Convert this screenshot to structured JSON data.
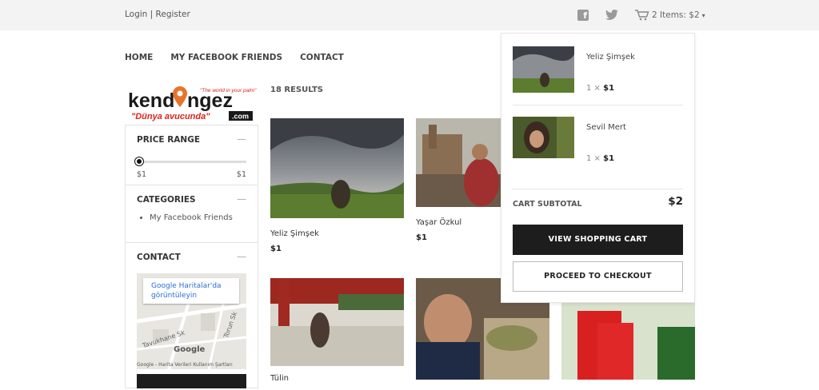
{
  "topbar": {
    "login": "Login",
    "sep": " | ",
    "register": "Register",
    "cart_link": "2 Items: $2"
  },
  "nav": {
    "items": [
      "HOME",
      "MY FACEBOOK FRIENDS",
      "CONTACT"
    ]
  },
  "logo": {
    "text_main": "kend",
    "text_rest": "ngez",
    "tagline": "\"The world in your palm\"",
    "subtitle": "\"Dünya avucunda\"",
    "dotcom": ".com"
  },
  "results": "18 RESULTS",
  "sidebar": {
    "price": {
      "title": "PRICE RANGE",
      "min": "$1",
      "max": "$1",
      "slider_position": 0
    },
    "categories": {
      "title": "CATEGORIES",
      "items": [
        "My Facebook Friends"
      ]
    },
    "contact": {
      "title": "CONTACT",
      "map_tip": "Google Haritalar'da görüntüleyin",
      "street1": "Tavukhane Sk",
      "street2": "Torun Sk",
      "map_footer": "Google - Harita Verileri   Kullanım Şartları",
      "google_logo": "Google"
    }
  },
  "products": [
    {
      "name": "Yeliz Şimşek",
      "price": "$1"
    },
    {
      "name": "Yaşar Özkul",
      "price": "$1"
    },
    {
      "name": "Tülin",
      "price": ""
    },
    {
      "name": "",
      "price": ""
    },
    {
      "name": "",
      "price": ""
    }
  ],
  "cart": {
    "items": [
      {
        "name": "Yeliz Şimşek",
        "qty": "1",
        "times": " × ",
        "price": "$1"
      },
      {
        "name": "Sevil Mert",
        "qty": "1",
        "times": " × ",
        "price": "$1"
      }
    ],
    "subtotal_label": "CART SUBTOTAL",
    "subtotal": "$2",
    "view_cart": "VIEW SHOPPING CART",
    "checkout": "PROCEED TO CHECKOUT"
  },
  "colors": {
    "accent": "#e8742a",
    "dark": "#1d1d1d",
    "link": "#2a6fd6"
  }
}
